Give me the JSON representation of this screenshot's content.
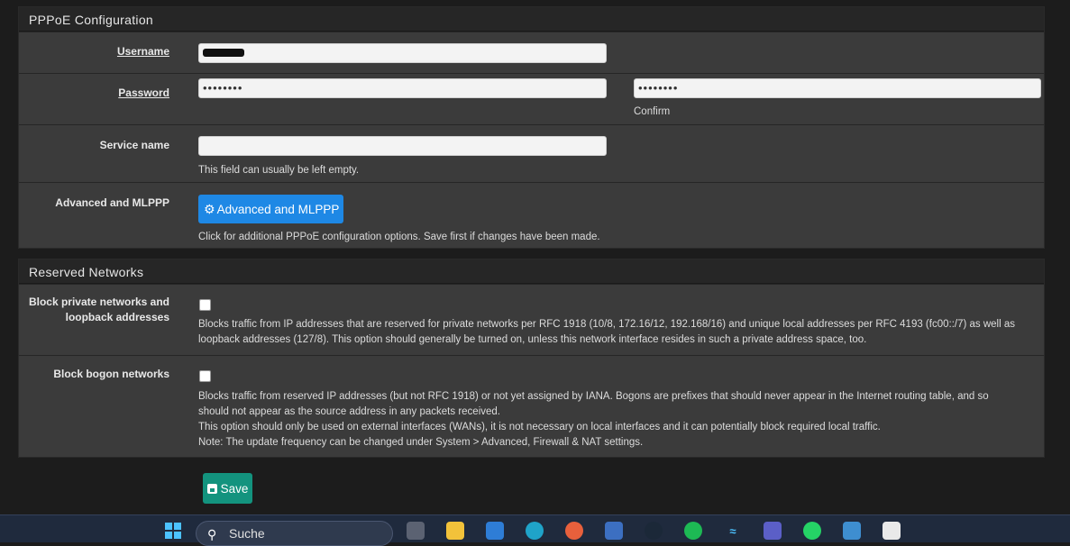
{
  "pppoe": {
    "title": "PPPoE Configuration",
    "username_label": "Username",
    "password_label": "Password",
    "password_value": "••••••••",
    "confirm_value": "••••••••",
    "confirm_label": "Confirm",
    "service_label": "Service name",
    "service_value": "",
    "service_help": "This field can usually be left empty.",
    "advanced_label": "Advanced and MLPPP",
    "advanced_button": "Advanced and MLPPP",
    "advanced_help": "Click for additional PPPoE configuration options. Save first if changes have been made."
  },
  "reserved": {
    "title": "Reserved Networks",
    "private_label_1": "Block private networks and",
    "private_label_2": "loopback addresses",
    "private_checked": false,
    "private_help_1": "Blocks traffic from IP addresses that are reserved for private networks per RFC 1918 (10/8, 172.16/12, 192.168/16) and unique local addresses per RFC 4193 (fc00::/7) as well as",
    "private_help_2": "loopback addresses (127/8). This option should generally be turned on, unless this network interface resides in such a private address space, too.",
    "bogon_label": "Block bogon networks",
    "bogon_checked": false,
    "bogon_help_1": "Blocks traffic from reserved IP addresses (but not RFC 1918) or not yet assigned by IANA. Bogons are prefixes that should never appear in the Internet routing table, and so",
    "bogon_help_2": "should not appear as the source address in any packets received.",
    "bogon_help_3": "This option should only be used on external interfaces (WANs), it is not necessary on local interfaces and it can potentially block required local traffic.",
    "bogon_help_4": "Note: The update frequency can be changed under System > Advanced, Firewall & NAT settings."
  },
  "save_button": "Save",
  "taskbar": {
    "search_placeholder": "Suche",
    "icons": [
      "start-icon",
      "task-view-icon",
      "file-explorer-icon",
      "store-icon",
      "edge-icon",
      "firefox-icon",
      "remote-desktop-icon",
      "steam-icon",
      "spotify-icon",
      "wifi-icon",
      "teams-icon",
      "whatsapp-icon",
      "photos-icon",
      "snipping-icon"
    ]
  }
}
